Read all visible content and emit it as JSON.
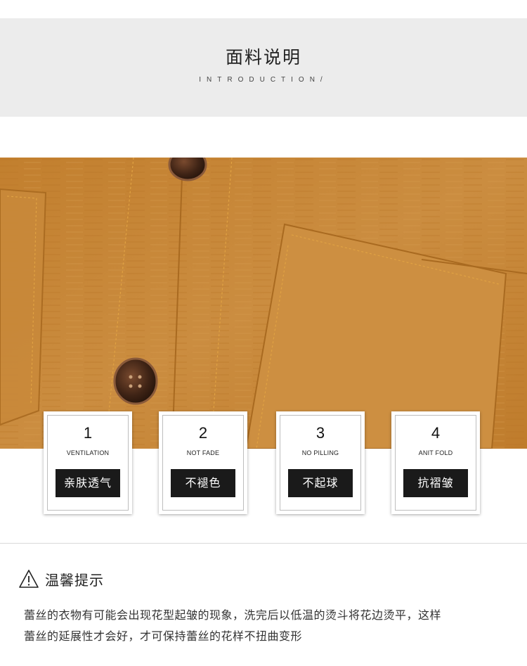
{
  "header": {
    "title": "面料说明",
    "subtitle": "INTRODUCTION/"
  },
  "features": [
    {
      "number": "1",
      "english": "VENTILATION",
      "chinese": "亲肤透气"
    },
    {
      "number": "2",
      "english": "NOT FADE",
      "chinese": "不褪色"
    },
    {
      "number": "3",
      "english": "NO PILLING",
      "chinese": "不起球"
    },
    {
      "number": "4",
      "english": "ANIT FOLD",
      "chinese": "抗褶皱"
    }
  ],
  "tips": {
    "icon": "warning-triangle-icon",
    "title": "温馨提示",
    "lines": [
      "蕾丝的衣物有可能会出现花型起皱的现象，洗完后以低温的烫斗将花边烫平，这样",
      "蕾丝的延展性才会好，才可保持蕾丝的花样不扭曲变形"
    ]
  },
  "colors": {
    "header_band": "#ececec",
    "fabric": "#c58637",
    "label_bg": "#1a1a1a"
  }
}
